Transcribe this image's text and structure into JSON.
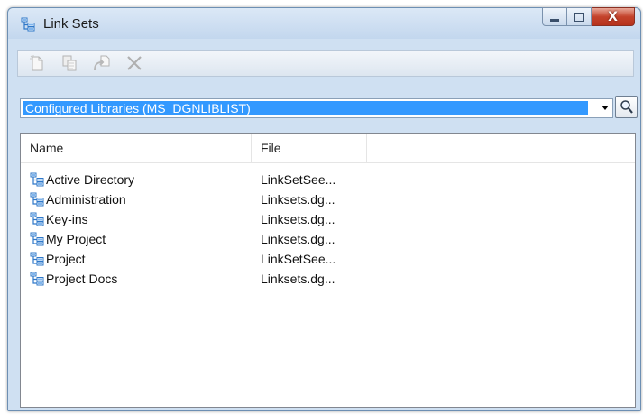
{
  "window": {
    "title": "Link Sets",
    "close_glyph": "X"
  },
  "toolbar": {
    "tools": [
      {
        "icon": "new-document-icon",
        "enabled": false
      },
      {
        "icon": "copy-icon",
        "enabled": false
      },
      {
        "icon": "paste-link-icon",
        "enabled": false
      },
      {
        "icon": "delete-x-icon",
        "enabled": false
      }
    ]
  },
  "library_select": {
    "selected": "Configured Libraries (MS_DGNLIBLIST)"
  },
  "list": {
    "columns": [
      "Name",
      "File"
    ],
    "rows": [
      {
        "name": "Active Directory",
        "file": "LinkSetSee..."
      },
      {
        "name": "Administration",
        "file": "Linksets.dg..."
      },
      {
        "name": "Key-ins",
        "file": "Linksets.dg..."
      },
      {
        "name": "My Project",
        "file": "Linksets.dg..."
      },
      {
        "name": "Project",
        "file": "LinkSetSee..."
      },
      {
        "name": "Project Docs",
        "file": "Linksets.dg..."
      }
    ]
  },
  "colors": {
    "selection": "#3399ff",
    "link_icon": "#2f78c9",
    "close_button": "#c4432c"
  }
}
